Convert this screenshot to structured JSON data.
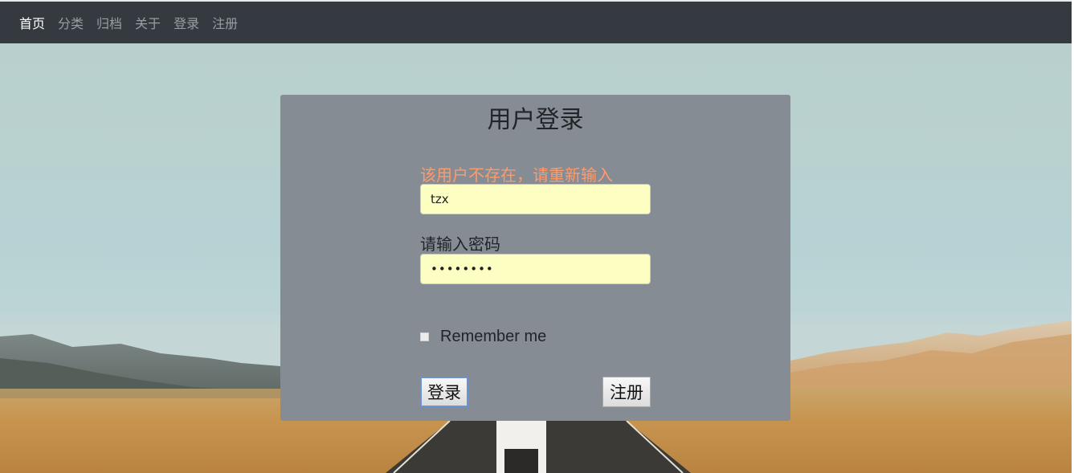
{
  "nav": {
    "items": [
      "首页",
      "分类",
      "归档",
      "关于",
      "登录",
      "注册"
    ]
  },
  "login": {
    "title": "用户登录",
    "error": "该用户不存在，请重新输入",
    "username_value": "tzx",
    "password_label": "请输入密码",
    "password_value": "••••••••",
    "remember_label": "Remember me",
    "remember_checked": false,
    "login_button": "登录",
    "register_button": "注册"
  },
  "colors": {
    "navbar": "#343a40",
    "panel": "#868c93",
    "error": "#ff9a6a",
    "input_bg": "#fcffc1"
  },
  "icons": {
    "background": "desert-road-landscape"
  }
}
